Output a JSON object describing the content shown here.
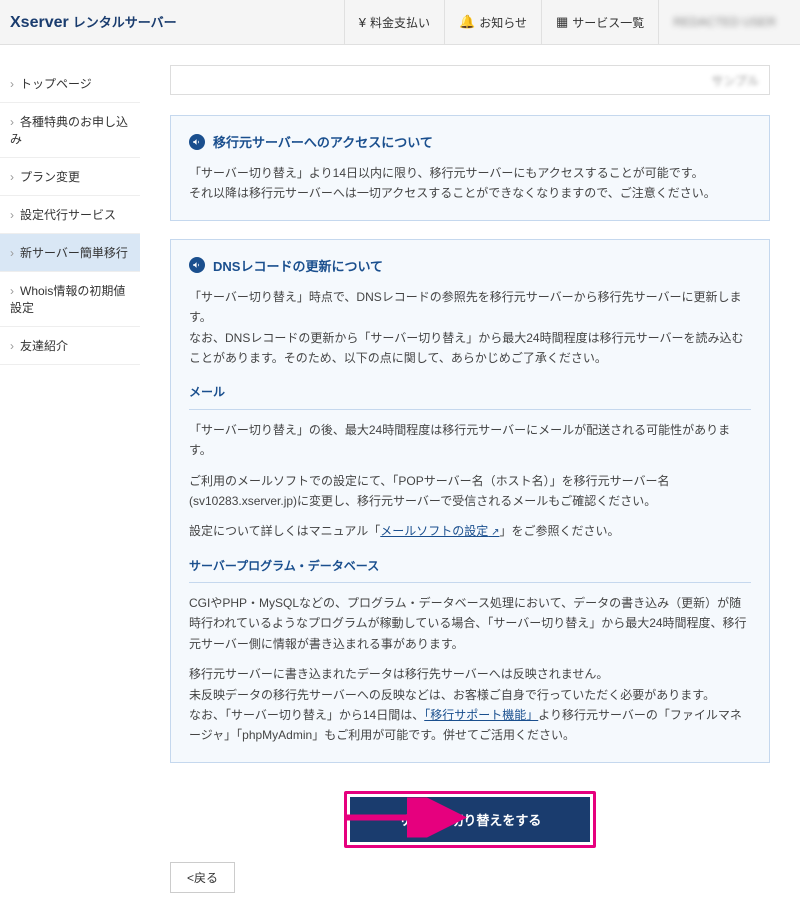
{
  "header": {
    "logo_primary": "Xserver",
    "logo_sub": "レンタルサーバー",
    "nav": {
      "payment": "料金支払い",
      "notice": "お知らせ",
      "services": "サービス一覧",
      "user": "REDACTED USER"
    }
  },
  "sidebar": {
    "items": [
      {
        "label": "トップページ"
      },
      {
        "label": "各種特典のお申し込み"
      },
      {
        "label": "プラン変更"
      },
      {
        "label": "設定代行サービス"
      },
      {
        "label": "新サーバー簡単移行",
        "active": true
      },
      {
        "label": "Whois情報の初期値設定"
      },
      {
        "label": "友達紹介"
      }
    ]
  },
  "stub": {
    "text": "サンプル"
  },
  "box_access": {
    "title": "移行元サーバーへのアクセスについて",
    "line1": "「サーバー切り替え」より14日以内に限り、移行元サーバーにもアクセスすることが可能です。",
    "line2": "それ以降は移行元サーバーへは一切アクセスすることができなくなりますので、ご注意ください。"
  },
  "box_dns": {
    "title": "DNSレコードの更新について",
    "line1": "「サーバー切り替え」時点で、DNSレコードの参照先を移行元サーバーから移行先サーバーに更新します。",
    "line2": "なお、DNSレコードの更新から「サーバー切り替え」から最大24時間程度は移行元サーバーを読み込むことがあります。そのため、以下の点に関して、あらかじめご了承ください。",
    "sub_mail": "メール",
    "mail_l1": "「サーバー切り替え」の後、最大24時間程度は移行元サーバーにメールが配送される可能性があります。",
    "mail_l2a": "ご利用のメールソフトでの設定にて、「POPサーバー名（ホスト名）」を移行元サーバー名(sv10283.xserver.jp)に変更し、移行元サーバーで受信されるメールもご確認ください。",
    "mail_l3_pre": "設定について詳しくはマニュアル「",
    "mail_l3_link": "メールソフトの設定",
    "mail_l3_post": "」をご参照ください。",
    "sub_prog": "サーバープログラム・データベース",
    "prog_l1": "CGIやPHP・MySQLなどの、プログラム・データベース処理において、データの書き込み（更新）が随時行われているようなプログラムが稼動している場合、「サーバー切り替え」から最大24時間程度、移行元サーバー側に情報が書き込まれる事があります。",
    "prog_l2": "移行元サーバーに書き込まれたデータは移行先サーバーへは反映されません。",
    "prog_l3": "未反映データの移行先サーバーへの反映などは、お客様ご自身で行っていただく必要があります。",
    "prog_l4_pre": "なお、「サーバー切り替え」から14日間は、",
    "prog_l4_link": "「移行サポート機能」",
    "prog_l4_post": "より移行元サーバーの「ファイルマネージャ」「phpMyAdmin」もご利用が可能です。併せてご活用ください。"
  },
  "action": {
    "primary": "サーバー切り替えをする",
    "back": "戻る"
  }
}
